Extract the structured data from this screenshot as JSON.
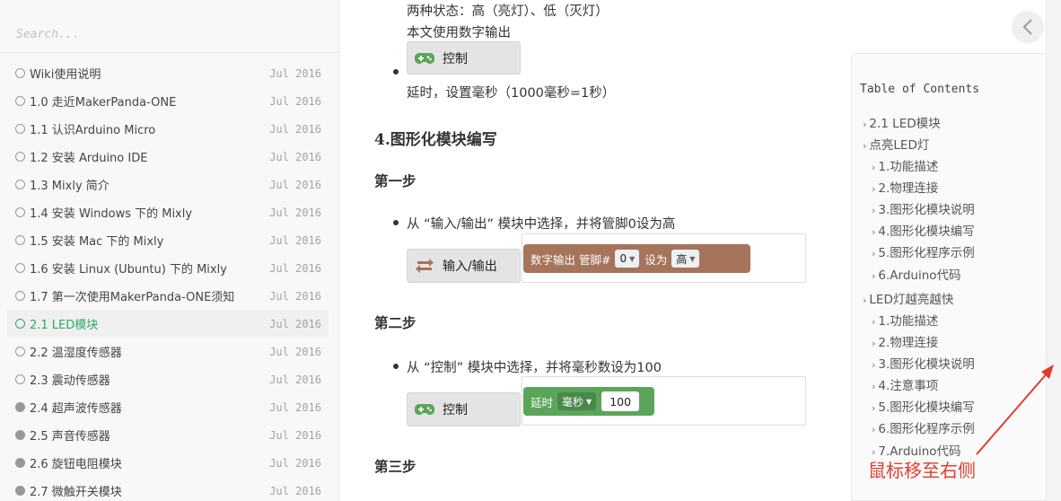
{
  "sidebar": {
    "search_placeholder": "Search...",
    "items": [
      {
        "label": "Wiki使用说明",
        "date": "Jul 2016",
        "status": "open"
      },
      {
        "label": "1.0 走近MakerPanda-ONE",
        "date": "Jul 2016",
        "status": "open"
      },
      {
        "label": "1.1 认识Arduino Micro",
        "date": "Jul 2016",
        "status": "open"
      },
      {
        "label": "1.2 安装 Arduino IDE",
        "date": "Jul 2016",
        "status": "open"
      },
      {
        "label": "1.3 Mixly 简介",
        "date": "Jul 2016",
        "status": "open"
      },
      {
        "label": "1.4 安装 Windows 下的 Mixly",
        "date": "Jul 2016",
        "status": "open"
      },
      {
        "label": "1.5 安装 Mac 下的 Mixly",
        "date": "Jul 2016",
        "status": "open"
      },
      {
        "label": "1.6 安装 Linux (Ubuntu) 下的 Mixly",
        "date": "Jul 2016",
        "status": "open"
      },
      {
        "label": "1.7 第一次使用MakerPanda-ONE须知",
        "date": "Jul 2016",
        "status": "open"
      },
      {
        "label": "2.1 LED模块",
        "date": "Jul 2016",
        "status": "active"
      },
      {
        "label": "2.2 温湿度传感器",
        "date": "Jul 2016",
        "status": "open"
      },
      {
        "label": "2.3 震动传感器",
        "date": "Jul 2016",
        "status": "open"
      },
      {
        "label": "2.4 超声波传感器",
        "date": "Jul 2016",
        "status": "filled"
      },
      {
        "label": "2.5 声音传感器",
        "date": "Jul 2016",
        "status": "filled"
      },
      {
        "label": "2.6 旋钮电阻模块",
        "date": "Jul 2016",
        "status": "filled"
      },
      {
        "label": "2.7 微触开关模块",
        "date": "Jul 2016",
        "status": "filled"
      }
    ]
  },
  "main": {
    "line1": "两种状态：高（亮灯）、低（灭灯）",
    "line2": "本文使用数字输出",
    "control_label": "控制",
    "delay_text": "延时，设置毫秒（1000毫秒=1秒）",
    "section_heading": "4.图形化模块编写",
    "step1": {
      "title": "第一步",
      "text": "从 “输入/输出” 模块中选择，并将管脚0设为高",
      "category_label": "输入/输出",
      "block": {
        "prefix": "数字输出 管脚#",
        "pin": "0",
        "mid": "设为",
        "value": "高"
      }
    },
    "step2": {
      "title": "第二步",
      "text": "从 “控制” 模块中选择，并将毫秒数设为100",
      "category_label": "控制",
      "block": {
        "prefix": "延时",
        "unit": "毫秒",
        "value": "100"
      }
    },
    "step3": {
      "title": "第三步"
    }
  },
  "toc": {
    "title": "Table of Contents",
    "items": [
      {
        "label": "2.1 LED模块",
        "level": 1
      },
      {
        "label": "点亮LED灯",
        "level": 1
      },
      {
        "label": "1.功能描述",
        "level": 2
      },
      {
        "label": "2.物理连接",
        "level": 2
      },
      {
        "label": "3.图形化模块说明",
        "level": 2
      },
      {
        "label": "4.图形化模块编写",
        "level": 2
      },
      {
        "label": "5.图形化程序示例",
        "level": 2
      },
      {
        "label": "6.Arduino代码",
        "level": 2
      },
      {
        "label": "LED灯越亮越快",
        "level": 1
      },
      {
        "label": "1.功能描述",
        "level": 2
      },
      {
        "label": "2.物理连接",
        "level": 2
      },
      {
        "label": "3.图形化模块说明",
        "level": 2
      },
      {
        "label": "4.注意事项",
        "level": 2
      },
      {
        "label": "5.图形化模块编写",
        "level": 2
      },
      {
        "label": "6.图形化程序示例",
        "level": 2
      },
      {
        "label": "7.Arduino代码",
        "level": 2
      }
    ]
  },
  "annotation": "鼠标移至右侧",
  "icons": {
    "collapse": "chevron-left-icon",
    "gamepad": "gamepad-icon",
    "io": "arrows-icon"
  },
  "colors": {
    "accent": "#2aa865",
    "io_block": "#a5745b",
    "control_block": "#5ba55b",
    "annotation": "#e23b2e"
  }
}
